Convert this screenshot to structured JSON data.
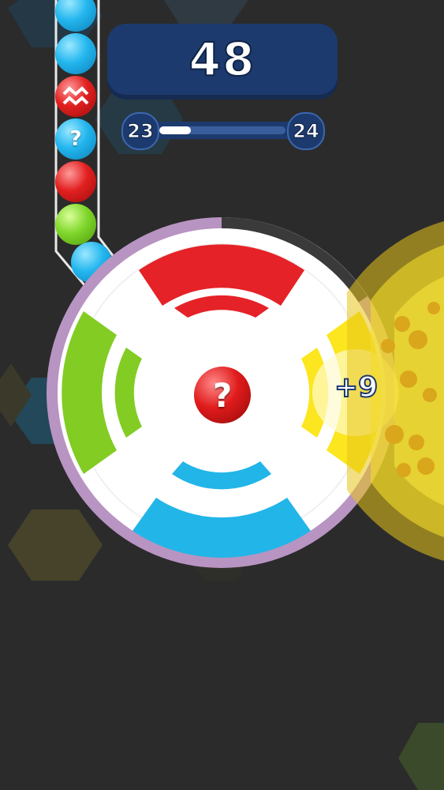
{
  "score": "48",
  "level": {
    "current": "23",
    "next": "24",
    "progress": 0.25
  },
  "tube_balls": [
    {
      "color": "blue",
      "icon": ""
    },
    {
      "color": "blue",
      "icon": ""
    },
    {
      "color": "red",
      "icon": "zigzag-icon"
    },
    {
      "color": "blue",
      "icon": "?"
    },
    {
      "color": "red",
      "icon": ""
    },
    {
      "color": "green",
      "icon": ""
    },
    {
      "color": "blue",
      "icon": ""
    }
  ],
  "center_ball": {
    "color": "red",
    "icon": "?"
  },
  "popup": "+9",
  "colors": {
    "background": "#2b2b2b",
    "panel": "#1d3a6e",
    "red": "#e52227",
    "blue": "#22b5e8",
    "green": "#82cc24",
    "yellow": "#fbe61f",
    "ring": "#b894c2"
  }
}
